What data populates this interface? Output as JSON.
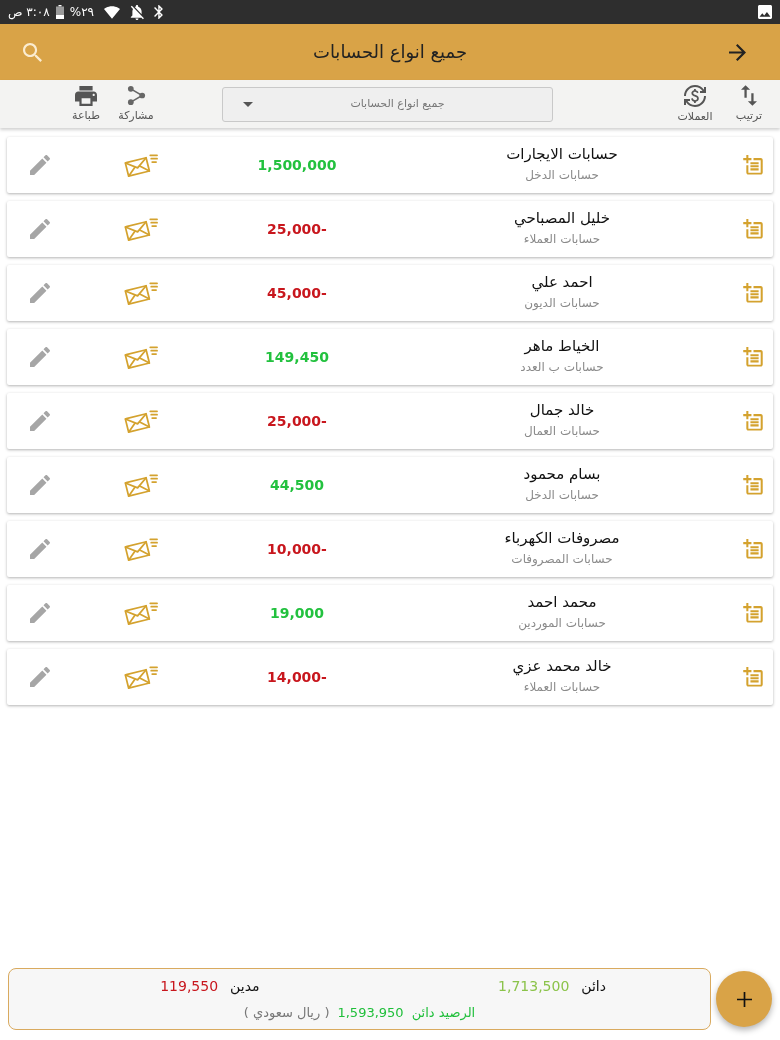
{
  "status_bar": {
    "time": "٣:٠٨ ص",
    "battery": "٢٩%"
  },
  "app_bar": {
    "title": "جميع انواع الحسابات"
  },
  "toolbar": {
    "start_actions": [
      {
        "kind": "sort",
        "label": "ترتيب"
      },
      {
        "kind": "currency",
        "label": "العملات"
      }
    ],
    "filter": {
      "value": "جميع انواع الحسابات"
    },
    "end_actions": [
      {
        "kind": "share",
        "label": "مشاركة"
      },
      {
        "kind": "print",
        "label": "طباعة"
      }
    ]
  },
  "accounts": [
    {
      "name": "حسابات الايجارات",
      "type": "حسابات الدخل",
      "balance": "1,500,000",
      "color": "#22c13e"
    },
    {
      "name": "خليل المصباحي",
      "type": "حسابات العملاء",
      "balance": "25,000-",
      "color": "#c8161d"
    },
    {
      "name": "احمد علي",
      "type": "حسابات الديون",
      "balance": "45,000-",
      "color": "#c8161d"
    },
    {
      "name": "الخياط ماهر",
      "type": "حسابات ب العدد",
      "balance": "149,450",
      "color": "#22c13e"
    },
    {
      "name": "خالد جمال",
      "type": "حسابات العمال",
      "balance": "25,000-",
      "color": "#c8161d"
    },
    {
      "name": "بسام محمود",
      "type": "حسابات الدخل",
      "balance": "44,500",
      "color": "#22c13e"
    },
    {
      "name": "مصروفات الكهرباء",
      "type": "حسابات المصروفات",
      "balance": "10,000-",
      "color": "#c8161d"
    },
    {
      "name": "محمد احمد",
      "type": "حسابات الموردين",
      "balance": "19,000",
      "color": "#22c13e"
    },
    {
      "name": "خالد محمد عزي",
      "type": "حسابات العملاء",
      "balance": "14,000-",
      "color": "#c8161d"
    }
  ],
  "summary": {
    "credit_label": "دائن",
    "credit": "1,713,500",
    "debit_label": "مدين",
    "debit": "119,550",
    "balance_label": "الرصيد دائن",
    "balance": "1,593,950",
    "currency": "( ريال سعودي )"
  }
}
